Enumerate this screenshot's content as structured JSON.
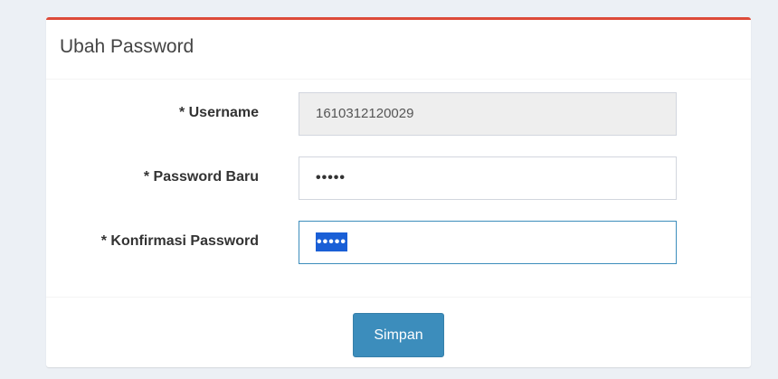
{
  "form": {
    "title": "Ubah Password",
    "fields": [
      {
        "label": "* Username",
        "value": "1610312120029",
        "state": "disabled"
      },
      {
        "label": "* Password Baru",
        "value": "•••••",
        "state": "normal"
      },
      {
        "label": "* Konfirmasi Password",
        "value": "•••••",
        "state": "focused-selected"
      }
    ],
    "submit_label": "Simpan"
  },
  "colors": {
    "accent_top_border": "#dd4b39",
    "primary_button": "#3c8dbc",
    "page_background": "#ecf0f5",
    "selection_highlight": "#1a5fd6"
  }
}
